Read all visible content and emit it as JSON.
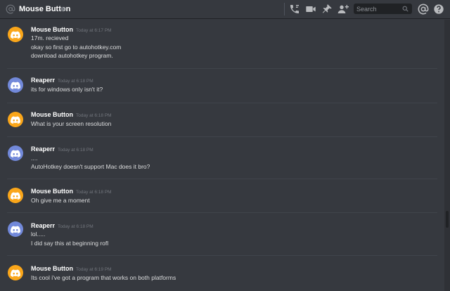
{
  "header": {
    "channel_name": "Mouse Button",
    "search_placeholder": "Search",
    "icons": [
      "at-icon",
      "settings-gear-icon",
      "call-icon",
      "video-icon",
      "pin-icon",
      "add-member-icon",
      "search-icon",
      "mentions-icon",
      "help-icon"
    ]
  },
  "colors": {
    "background": "#36393f",
    "header_text": "#ffffff",
    "avatar_orange": "#faa61a",
    "avatar_blurple": "#7289da",
    "timestamp": "#72767d"
  },
  "messages": [
    {
      "author": "Mouse Button",
      "avatar": "orange",
      "timestamp": "Today at 6:17 PM",
      "lines": [
        "17m. recieved",
        "okay so first go to autohotkey.com",
        "download autohotkey program."
      ]
    },
    {
      "author": "Reaperr",
      "avatar": "blurple",
      "timestamp": "Today at 6:18 PM",
      "lines": [
        "its for windows only isn't it?"
      ]
    },
    {
      "author": "Mouse Button",
      "avatar": "orange",
      "timestamp": "Today at 6:18 PM",
      "lines": [
        "What is your screen resolution"
      ]
    },
    {
      "author": "Reaperr",
      "avatar": "blurple",
      "timestamp": "Today at 6:18 PM",
      "lines": [
        "....",
        "AutoHotkey doesn't support Mac does it bro?"
      ]
    },
    {
      "author": "Mouse Button",
      "avatar": "orange",
      "timestamp": "Today at 6:18 PM",
      "lines": [
        "Oh give me a moment"
      ]
    },
    {
      "author": "Reaperr",
      "avatar": "blurple",
      "timestamp": "Today at 6:18 PM",
      "lines": [
        "lol.....",
        "I did say this at beginning rofl"
      ]
    },
    {
      "author": "Mouse Button",
      "avatar": "orange",
      "timestamp": "Today at 6:19 PM",
      "lines": [
        "Its cool i've got a program that works on both platforms"
      ]
    }
  ]
}
